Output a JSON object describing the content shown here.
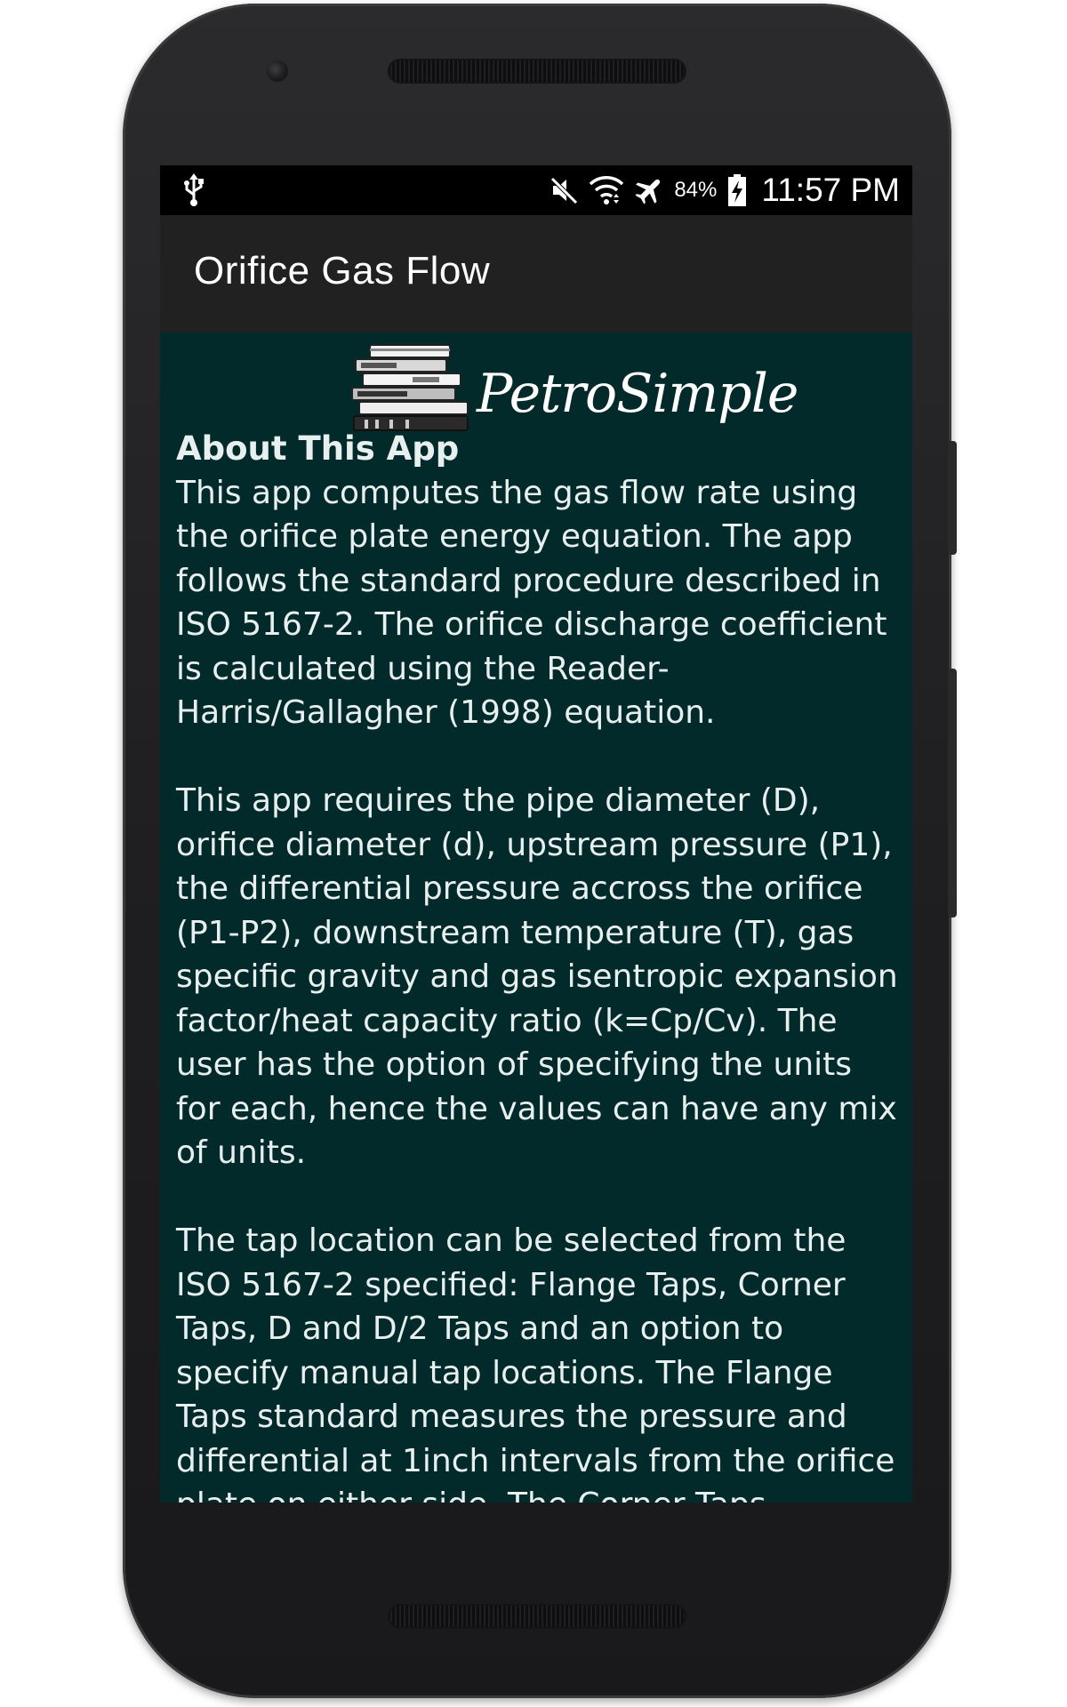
{
  "status_bar": {
    "battery_percent": "84%",
    "time": "11:57 PM",
    "icons": [
      "usb-icon",
      "mute-icon",
      "wifi-icon",
      "airplane-icon",
      "battery-charging-icon"
    ]
  },
  "app_bar": {
    "title": "Orifice Gas Flow"
  },
  "logo": {
    "text": "PetroSimple"
  },
  "about": {
    "heading": "About This App",
    "paragraphs": [
      "This app computes the gas flow rate using the orifice plate energy equation. The app follows the standard procedure described in ISO 5167-2. The orifice discharge coefficient is calculated using the Reader-Harris/Gallagher (1998) equation.",
      "This app requires the pipe diameter (D), orifice diameter (d), upstream pressure (P1), the differential pressure accross the orifice (P1-P2), downstream temperature (T), gas specific gravity and gas isentropic expansion factor/heat capacity ratio (k=Cp/Cv). The user has the option of specifying the units for each, hence the values can have any mix of units.",
      "The tap location can be selected from the ISO 5167-2 specified: Flange Taps, Corner Taps, D and D/2 Taps and an option to specify manual tap locations. The Flange Taps standard measures the pressure and differential at 1inch intervals from the orifice plate on either side. The Corner Taps"
    ]
  },
  "colors": {
    "content_background": "#032a2a",
    "app_bar_background": "#212121",
    "status_bar_background": "#000000",
    "text": "#e8f0ef"
  }
}
